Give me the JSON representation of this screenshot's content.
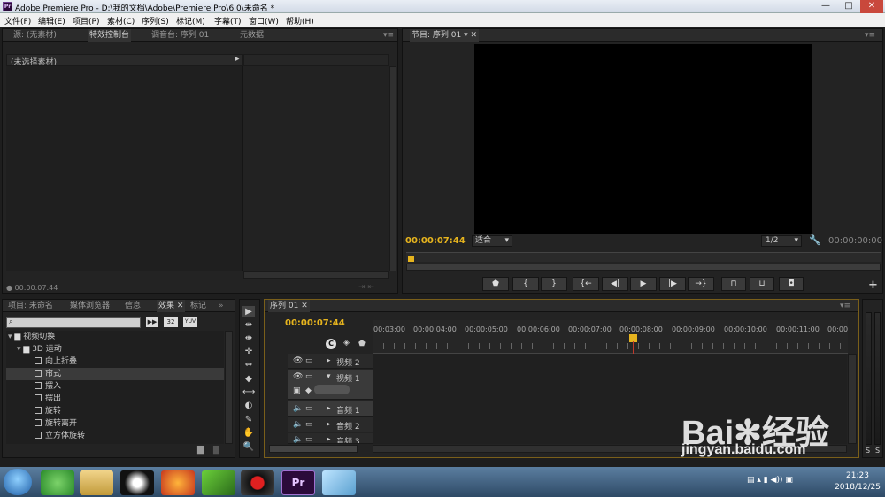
{
  "window": {
    "icon_text": "Pr",
    "title": "Adobe Premiere Pro - D:\\我的文档\\Adobe\\Premiere Pro\\6.0\\未命名 *",
    "minimize": "—",
    "maximize": "□",
    "close": "✕"
  },
  "menu": [
    "文件(F)",
    "编辑(E)",
    "项目(P)",
    "素材(C)",
    "序列(S)",
    "标记(M)",
    "字幕(T)",
    "窗口(W)",
    "帮助(H)"
  ],
  "source_panel": {
    "tabs": [
      "源: (无素材)",
      "特效控制台",
      "调音台: 序列 01",
      "元数据"
    ],
    "active_tab": 1,
    "no_clip": "(未选择素材)",
    "timecode": "00:00:07:44"
  },
  "program_monitor": {
    "tab": "节目: 序列 01",
    "timecode": "00:00:07:44",
    "fit": "适合",
    "resolution": "1/2",
    "duration": "00:00:00:00",
    "controls": [
      "marker-icon",
      "in-point-icon",
      "out-point-icon",
      "go-to-in-icon",
      "step-back-icon",
      "play-icon",
      "step-forward-icon",
      "go-to-out-icon",
      "lift-icon",
      "extract-icon",
      "export-frame-icon"
    ],
    "control_glyphs": [
      "⬟",
      "{",
      "}",
      "{←",
      "◀|",
      "▶",
      "|▶",
      "→}",
      "⊓",
      "⊔",
      "◘"
    ],
    "add_button": "+"
  },
  "project_panel": {
    "tabs": [
      "项目: 未命名",
      "媒体浏览器",
      "信息",
      "效果",
      "标记"
    ],
    "active_tab": 3,
    "badges": [
      "32",
      "YUV"
    ],
    "tree": [
      {
        "label": "视频切换",
        "type": "folder",
        "level": 0
      },
      {
        "label": "3D 运动",
        "type": "folder",
        "level": 1
      },
      {
        "label": "向上折叠",
        "type": "effect",
        "level": 2
      },
      {
        "label": "帘式",
        "type": "effect",
        "level": 2,
        "selected": true
      },
      {
        "label": "摆入",
        "type": "effect",
        "level": 2
      },
      {
        "label": "摆出",
        "type": "effect",
        "level": 2
      },
      {
        "label": "旋转",
        "type": "effect",
        "level": 2
      },
      {
        "label": "旋转离开",
        "type": "effect",
        "level": 2
      },
      {
        "label": "立方体旋转",
        "type": "effect",
        "level": 2
      }
    ]
  },
  "tools": [
    "▶",
    "⇹",
    "⇼",
    "✛",
    "⇔",
    "◆",
    "⟷",
    "◐",
    "✎",
    "✋",
    "🔍"
  ],
  "tool_names": [
    "selection-tool",
    "track-select-tool",
    "ripple-edit-tool",
    "rolling-edit-tool",
    "rate-stretch-tool",
    "razor-tool",
    "slip-tool",
    "slide-tool",
    "pen-tool",
    "hand-tool",
    "zoom-tool"
  ],
  "timeline": {
    "tab": "序列 01",
    "timecode": "00:00:07:44",
    "ruler": [
      "00:03:00",
      "00:00:04:00",
      "00:00:05:00",
      "00:00:06:00",
      "00:00:07:00",
      "00:00:08:00",
      "00:00:09:00",
      "00:00:10:00",
      "00:00:11:00",
      "00:00"
    ],
    "tracks": [
      {
        "name": "视频 2",
        "kind": "video"
      },
      {
        "name": "视频 1",
        "kind": "video",
        "expanded": true
      },
      {
        "name": "音频 1",
        "kind": "audio"
      },
      {
        "name": "音频 2",
        "kind": "audio"
      },
      {
        "name": "音频 3",
        "kind": "audio"
      }
    ],
    "meter_labels": [
      "S",
      "S"
    ]
  },
  "taskbar": {
    "time": "21:23",
    "date": "2018/12/25",
    "apps": [
      "start-button",
      "360-browser-icon",
      "file-explorer-icon",
      "qq-icon",
      "firefox-icon",
      "camtasia-icon",
      "recorder-icon",
      "premiere-icon",
      "notepad-icon"
    ]
  },
  "watermark": {
    "text": "Bai du 经验",
    "url": "jingyan.baidu.com"
  }
}
